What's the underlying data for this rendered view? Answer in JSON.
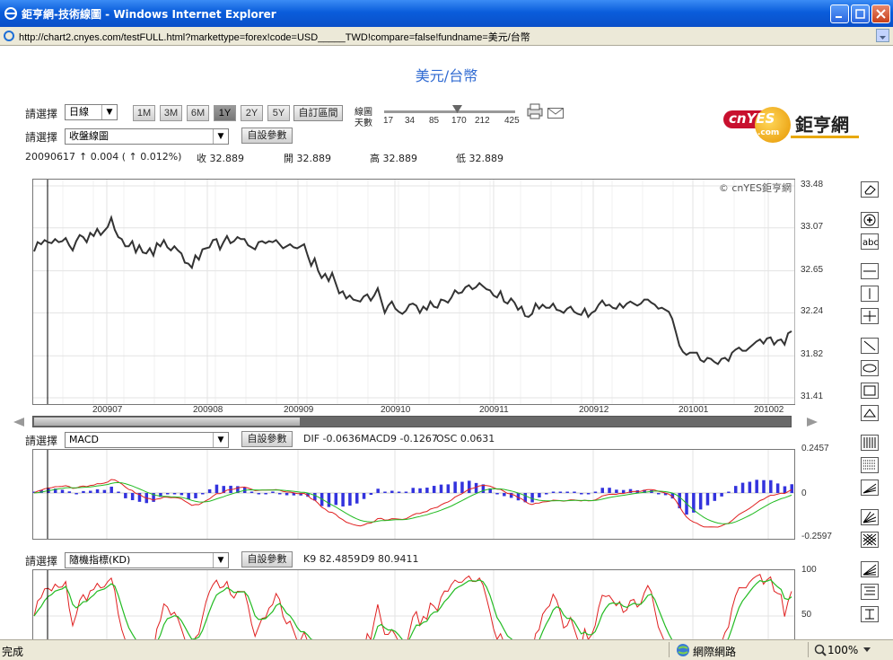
{
  "window": {
    "title": "鉅亨網-技術線圖 - Windows Internet Explorer"
  },
  "address": {
    "url": "http://chart2.cnyes.com/testFULL.html?markettype=forex!code=USD_____TWD!compare=false!fundname=美元/台幣"
  },
  "page": {
    "symbol_title": "美元/台幣",
    "select_label": "請選擇",
    "interval_value": "日線",
    "chart_type_value": "收盤線圖",
    "custom_params_label": "自設參數",
    "periods": [
      "1M",
      "3M",
      "6M",
      "1Y",
      "2Y",
      "5Y"
    ],
    "active_period": "1Y",
    "custom_range_label": "自訂區間",
    "ma_label_1": "線圖",
    "ma_label_2": "天數",
    "ma_days": [
      "17",
      "34",
      "85",
      "170",
      "212",
      "425"
    ],
    "logo_text": "cnYES",
    "logo_com": ".com",
    "logo_cn": "鉅亨網",
    "quote": {
      "date": "20090617",
      "change": "↑ 0.004 ( ↑ 0.012%)",
      "close": "收 32.889",
      "open": "開 32.889",
      "high": "高 32.889",
      "low": "低 32.889"
    },
    "copyright": "© cnYES鉅亨網",
    "macd": {
      "select_value": "MACD",
      "dif": "DIF -0.0636",
      "macd9": "MACD9 -0.1267",
      "osc": "OSC 0.0631"
    },
    "kd": {
      "select_value": "隨機指標(KD)",
      "k9": "K9 82.4859",
      "d9": "D9 80.9411"
    }
  },
  "status": {
    "done": "完成",
    "zone": "網際網路",
    "zoom": "100%"
  },
  "chart_data": [
    {
      "type": "line",
      "title": "美元/台幣",
      "x_tick_labels": [
        "200907",
        "200908",
        "200909",
        "200910",
        "200911",
        "200912",
        "201001",
        "201002"
      ],
      "y_tick_labels": [
        "33.48",
        "33.07",
        "32.65",
        "32.24",
        "31.82",
        "31.41"
      ],
      "ylim": [
        31.41,
        33.48
      ],
      "grid": true,
      "series": [
        {
          "values": [
            32.84,
            32.93,
            32.91,
            32.95,
            32.93,
            32.92,
            32.96,
            32.93,
            32.94,
            32.97,
            32.9,
            32.85,
            32.94,
            33.0,
            32.98,
            32.93,
            33.02,
            32.99,
            33.06,
            33.0,
            33.04,
            33.08,
            33.17,
            33.05,
            32.98,
            32.96,
            32.89,
            32.89,
            32.94,
            32.83,
            32.9,
            32.83,
            32.82,
            32.87,
            32.8,
            32.92,
            32.89,
            32.95,
            32.88,
            32.85,
            32.89,
            32.85,
            32.82,
            32.73,
            32.72,
            32.68,
            32.8,
            32.76,
            32.86,
            32.87,
            32.88,
            32.95,
            32.96,
            32.86,
            32.93,
            32.99,
            32.92,
            32.94,
            32.98,
            32.96,
            32.96,
            32.9,
            32.88,
            32.86,
            32.93,
            32.94,
            32.92,
            32.94,
            32.93,
            32.95,
            32.91,
            32.87,
            32.89,
            32.91,
            32.88,
            32.87,
            32.89,
            32.91,
            32.8,
            32.7,
            32.77,
            32.65,
            32.58,
            32.62,
            32.55,
            32.63,
            32.53,
            32.43,
            32.45,
            32.38,
            32.41,
            32.37,
            32.36,
            32.35,
            32.4,
            32.42,
            32.36,
            32.41,
            32.48,
            32.36,
            32.24,
            32.31,
            32.35,
            32.28,
            32.25,
            32.23,
            32.26,
            32.32,
            32.33,
            32.31,
            32.24,
            32.3,
            32.27,
            32.35,
            32.3,
            32.29,
            32.37,
            32.36,
            32.34,
            32.39,
            32.46,
            32.43,
            32.44,
            32.49,
            32.51,
            32.47,
            32.49,
            32.53,
            32.5,
            32.47,
            32.46,
            32.41,
            32.39,
            32.45,
            32.35,
            32.33,
            32.38,
            32.34,
            32.27,
            32.3,
            32.21,
            32.2,
            32.23,
            32.33,
            32.28,
            32.32,
            32.29,
            32.29,
            32.33,
            32.27,
            32.26,
            32.24,
            32.28,
            32.3,
            32.25,
            32.23,
            32.22,
            32.28,
            32.2,
            32.24,
            32.26,
            32.32,
            32.36,
            32.31,
            32.32,
            32.29,
            32.28,
            32.33,
            32.29,
            32.33,
            32.35,
            32.33,
            32.31,
            32.33,
            32.37,
            32.37,
            32.34,
            32.32,
            32.28,
            32.29,
            32.27,
            32.25,
            32.18,
            32.05,
            31.92,
            31.86,
            31.83,
            31.85,
            31.85,
            31.85,
            31.78,
            31.76,
            31.8,
            31.79,
            31.76,
            31.74,
            31.79,
            31.8,
            31.77,
            31.85,
            31.88,
            31.9,
            31.87,
            31.87,
            31.9,
            31.93,
            31.96,
            31.98,
            31.94,
            31.99,
            32.0,
            31.93,
            31.97,
            31.98,
            31.93,
            32.04,
            32.06
          ]
        }
      ]
    },
    {
      "type": "bar",
      "title": "MACD",
      "y_tick_labels": [
        "0.2457",
        "0",
        "-0.2597"
      ],
      "ylim": [
        -0.2597,
        0.2457
      ],
      "series": [
        {
          "name": "DIF",
          "color": "#e02020"
        },
        {
          "name": "MACD9",
          "color": "#22bb22"
        },
        {
          "name": "OSC",
          "color": "#3333dd"
        }
      ]
    },
    {
      "type": "line",
      "title": "隨機指標(KD)",
      "y_tick_labels": [
        "100",
        "50"
      ],
      "series": [
        {
          "name": "K9",
          "color": "#e02020"
        },
        {
          "name": "D9",
          "color": "#22bb22"
        }
      ]
    }
  ]
}
